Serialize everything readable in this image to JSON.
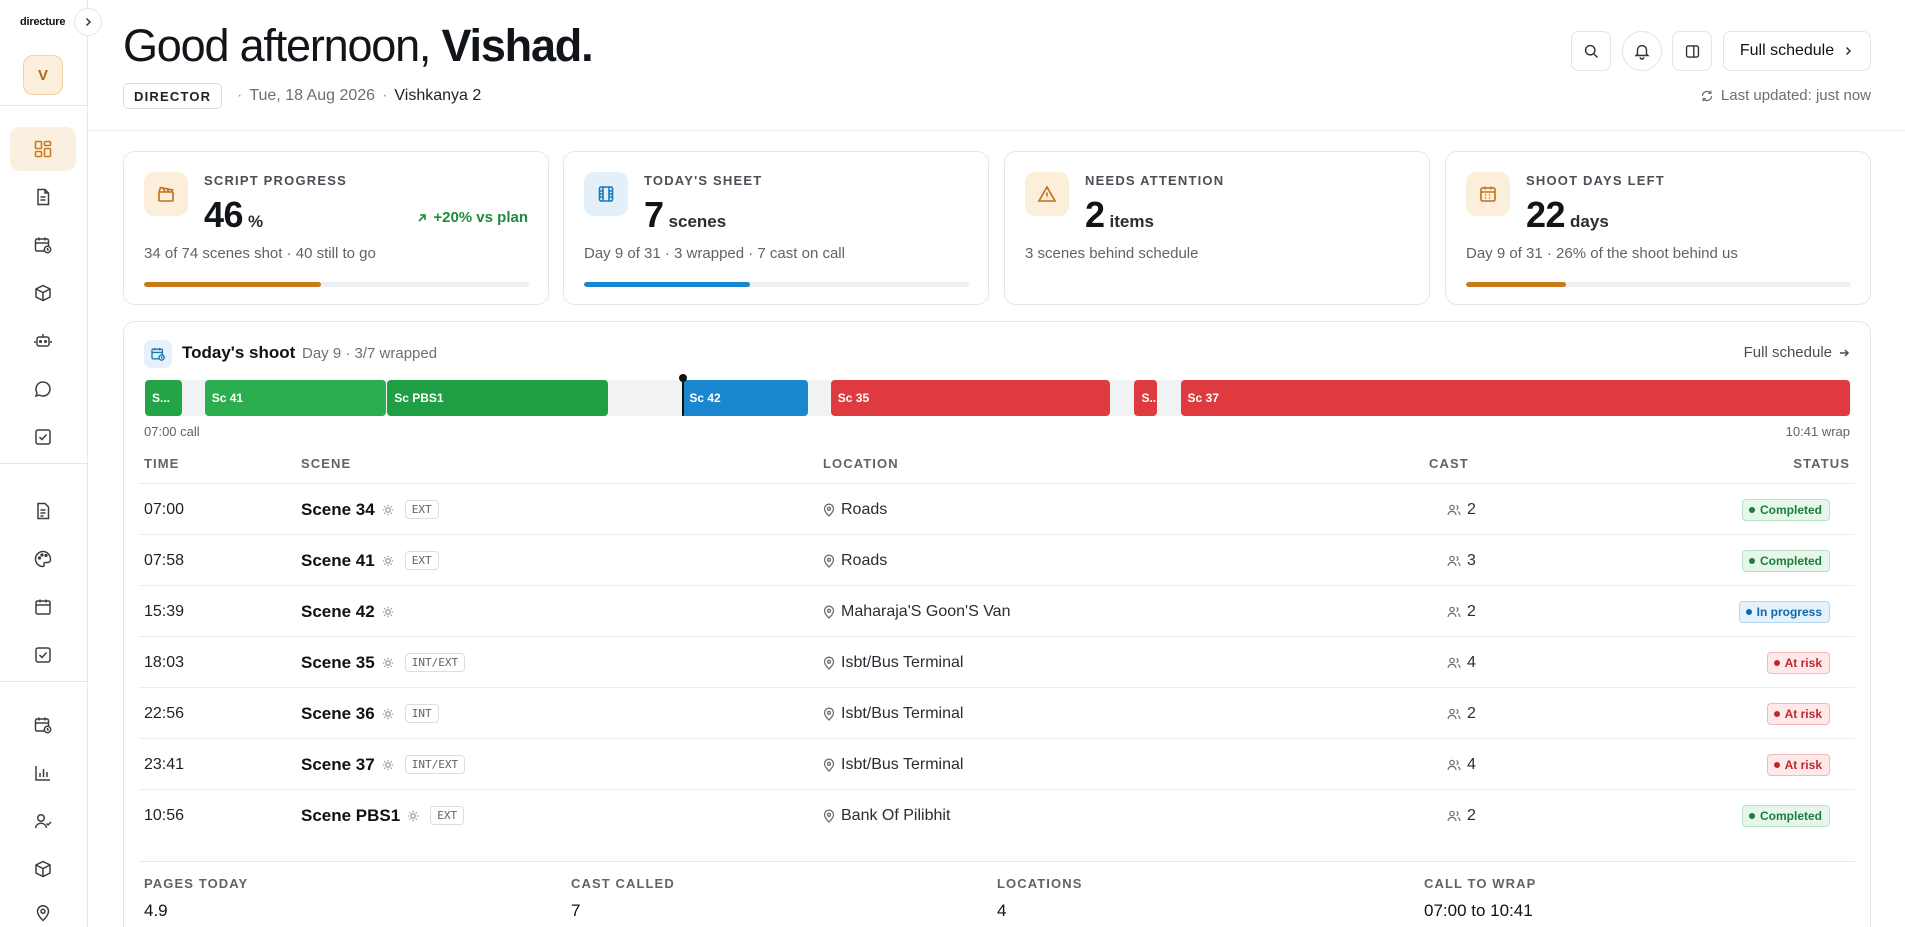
{
  "brand": "directure",
  "user_initial": "V",
  "header": {
    "greeting_prefix": "Good afternoon, ",
    "user_name": "Vishad.",
    "role": "DIRECTOR",
    "date": "Tue, 18 Aug 2026",
    "project": "Vishkanya 2",
    "full_schedule_label": "Full schedule",
    "last_updated": "Last updated: just now"
  },
  "kpis": [
    {
      "label": "SCRIPT PROGRESS",
      "value": "46",
      "unit": "%",
      "delta": "+20% vs plan",
      "sub": "34 of 74 scenes shot · 40 still to go",
      "progress": 0.46,
      "color": "#c97a1c",
      "icon_bg": "#fbeedb",
      "icon": "clapperboard-icon"
    },
    {
      "label": "TODAY'S SHEET",
      "value": "7",
      "unit": "scenes",
      "delta": "",
      "sub": "Day 9 of 31 · 3 wrapped · 7 cast on call",
      "progress": 0.43,
      "color": "#1a86cf",
      "icon_bg": "#e3f0fa",
      "icon": "film-icon"
    },
    {
      "label": "NEEDS ATTENTION",
      "value": "2",
      "unit": "items",
      "delta": "",
      "sub": "3 scenes behind schedule",
      "progress": null,
      "color": "#c97a1c",
      "icon_bg": "#fbeedb",
      "icon": "warning-icon"
    },
    {
      "label": "SHOOT DAYS LEFT",
      "value": "22",
      "unit": "days",
      "delta": "",
      "sub": "Day 9 of 31 · 26% of the shoot behind us",
      "progress": 0.26,
      "color": "#c97a1c",
      "icon_bg": "#fbeedb",
      "icon": "calendar-icon"
    }
  ],
  "shoot": {
    "title": "Today's shoot",
    "subtitle": "Day 9 · 3/7 wrapped",
    "link": "Full schedule",
    "call_label": "07:00 call",
    "wrap_label": "10:41 wrap",
    "timeline": [
      {
        "label": "S...",
        "start": 0.0,
        "end": 0.022,
        "color": "#22a447"
      },
      {
        "label": "Sc 41",
        "start": 0.035,
        "end": 0.142,
        "color": "#2bae4f"
      },
      {
        "label": "Sc PBS1",
        "start": 0.142,
        "end": 0.272,
        "color": "#1f9e43"
      },
      {
        "label": "Sc 42",
        "start": 0.315,
        "end": 0.389,
        "color": "#1a86cf"
      },
      {
        "label": "Sc 35",
        "start": 0.402,
        "end": 0.566,
        "color": "#de3a3f"
      },
      {
        "label": "S...",
        "start": 0.58,
        "end": 0.594,
        "color": "#de3a3f"
      },
      {
        "label": "Sc 37",
        "start": 0.607,
        "end": 1.0,
        "color": "#de3a3f"
      }
    ],
    "now_position": 0.315,
    "columns": {
      "time": "TIME",
      "scene": "SCENE",
      "location": "LOCATION",
      "cast": "CAST",
      "status": "STATUS"
    },
    "rows": [
      {
        "time": "07:00",
        "scene": "Scene 34",
        "tag": "EXT",
        "location": "Roads",
        "cast": "2",
        "status": "Completed",
        "kind": "done"
      },
      {
        "time": "07:58",
        "scene": "Scene 41",
        "tag": "EXT",
        "location": "Roads",
        "cast": "3",
        "status": "Completed",
        "kind": "done"
      },
      {
        "time": "15:39",
        "scene": "Scene 42",
        "tag": "",
        "location": "Maharaja'S Goon'S Van",
        "cast": "2",
        "status": "In progress",
        "kind": "prog"
      },
      {
        "time": "18:03",
        "scene": "Scene 35",
        "tag": "INT/EXT",
        "location": "Isbt/Bus Terminal",
        "cast": "4",
        "status": "At risk",
        "kind": "risk"
      },
      {
        "time": "22:56",
        "scene": "Scene 36",
        "tag": "INT",
        "location": "Isbt/Bus Terminal",
        "cast": "2",
        "status": "At risk",
        "kind": "risk"
      },
      {
        "time": "23:41",
        "scene": "Scene 37",
        "tag": "INT/EXT",
        "location": "Isbt/Bus Terminal",
        "cast": "4",
        "status": "At risk",
        "kind": "risk"
      },
      {
        "time": "10:56",
        "scene": "Scene PBS1",
        "tag": "EXT",
        "location": "Bank Of Pilibhit",
        "cast": "2",
        "status": "Completed",
        "kind": "done"
      }
    ],
    "summary": [
      {
        "label": "PAGES TODAY",
        "value": "4.9"
      },
      {
        "label": "CAST CALLED",
        "value": "7"
      },
      {
        "label": "LOCATIONS",
        "value": "4"
      },
      {
        "label": "CALL TO WRAP",
        "value": "07:00 to 10:41"
      }
    ]
  },
  "nav": {
    "group1": [
      "dashboard-icon",
      "script-icon",
      "schedule-icon",
      "props-icon",
      "assistant-icon",
      "chat-icon",
      "tasks-icon"
    ],
    "group2": [
      "documents-icon",
      "palette-icon",
      "calendar-icon",
      "checklist-icon"
    ],
    "group3": [
      "timer-icon",
      "reports-icon",
      "crew-icon",
      "inventory-icon",
      "location-icon"
    ]
  }
}
